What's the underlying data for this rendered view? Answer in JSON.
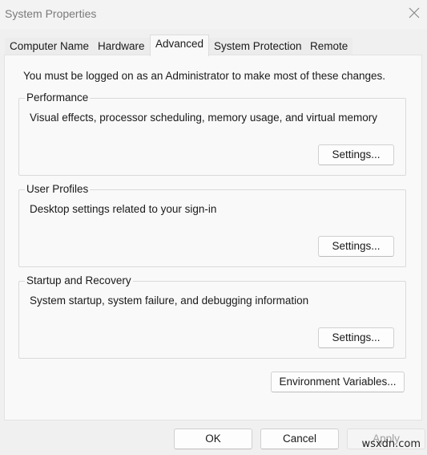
{
  "window": {
    "title": "System Properties",
    "close_icon": "close-icon"
  },
  "tabs": [
    {
      "label": "Computer Name",
      "active": false
    },
    {
      "label": "Hardware",
      "active": false
    },
    {
      "label": "Advanced",
      "active": true
    },
    {
      "label": "System Protection",
      "active": false
    },
    {
      "label": "Remote",
      "active": false
    }
  ],
  "advanced": {
    "admin_note": "You must be logged on as an Administrator to make most of these changes.",
    "groups": [
      {
        "label": "Performance",
        "description": "Visual effects, processor scheduling, memory usage, and virtual memory",
        "button": "Settings..."
      },
      {
        "label": "User Profiles",
        "description": "Desktop settings related to your sign-in",
        "button": "Settings..."
      },
      {
        "label": "Startup and Recovery",
        "description": "System startup, system failure, and debugging information",
        "button": "Settings..."
      }
    ],
    "env_button": "Environment Variables..."
  },
  "footer": {
    "ok": "OK",
    "cancel": "Cancel",
    "apply": "Apply",
    "apply_enabled": false
  },
  "watermark": "wsxdn.com"
}
